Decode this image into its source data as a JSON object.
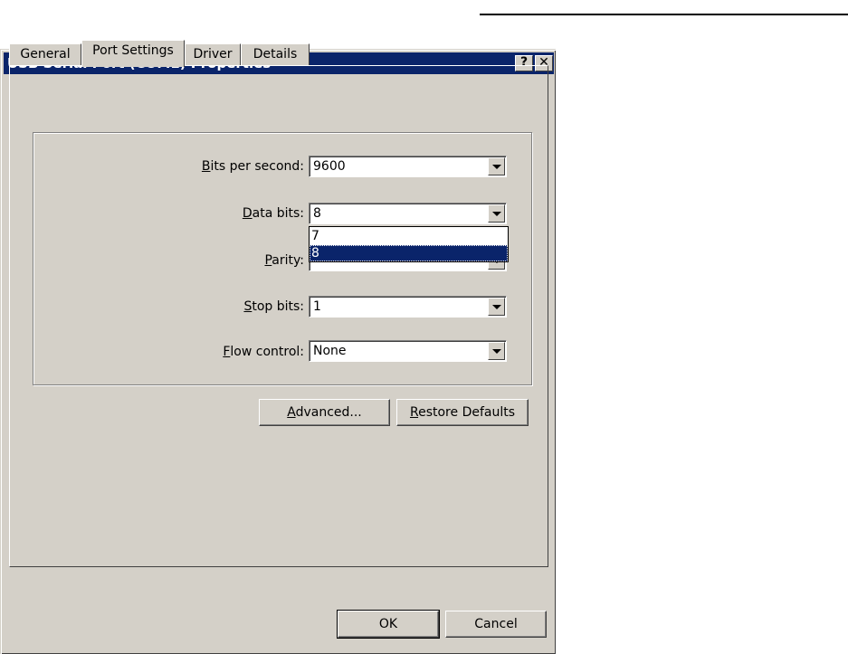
{
  "window": {
    "title": "USB Serial Port (COM1) Properties",
    "help_glyph": "?",
    "close_glyph": "✕"
  },
  "tabs": [
    {
      "label": "General"
    },
    {
      "label": "Port Settings",
      "active": true
    },
    {
      "label": "Driver"
    },
    {
      "label": "Details"
    }
  ],
  "fields": {
    "bits_per_second": {
      "label_prefix": "",
      "label_accel": "B",
      "label_rest": "its per second:",
      "value": "9600"
    },
    "data_bits": {
      "label_prefix": "",
      "label_accel": "D",
      "label_rest": "ata bits:",
      "value": "8"
    },
    "parity": {
      "label_prefix": "",
      "label_accel": "P",
      "label_rest": "arity:",
      "value": ""
    },
    "stop_bits": {
      "label_prefix": "",
      "label_accel": "S",
      "label_rest": "top bits:",
      "value": "1"
    },
    "flow_control": {
      "label_prefix": "",
      "label_accel": "F",
      "label_rest": "low control:",
      "value": "None"
    }
  },
  "dropdown": {
    "options": [
      "7",
      "8"
    ],
    "selected": "8"
  },
  "buttons": {
    "advanced": {
      "accel": "A",
      "rest": "dvanced..."
    },
    "restore": {
      "accel": "R",
      "rest": "estore Defaults"
    },
    "ok": "OK",
    "cancel": "Cancel"
  },
  "colors": {
    "titlebar": "#0a246a",
    "face": "#d4d0c8",
    "selection": "#0a246a"
  }
}
